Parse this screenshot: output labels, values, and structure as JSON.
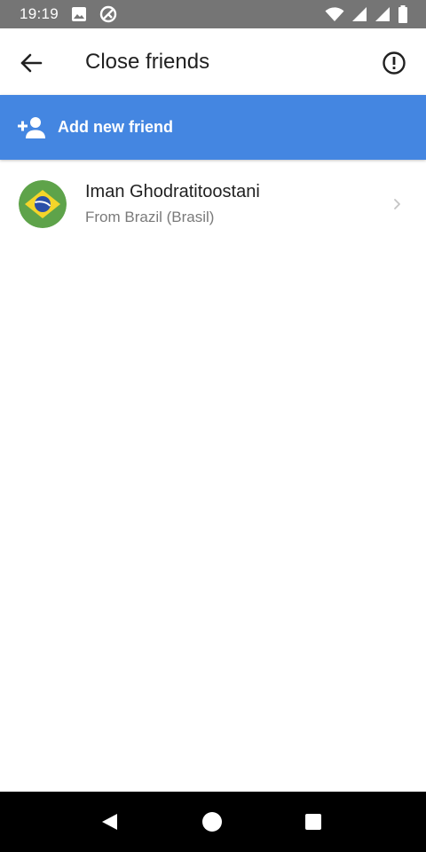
{
  "status_bar": {
    "time": "19:19",
    "icons": [
      "image-icon",
      "sync-icon",
      "wifi-icon",
      "signal-icon",
      "signal-icon-2",
      "battery-icon"
    ]
  },
  "app_bar": {
    "title": "Close friends",
    "back_icon": "arrow-left-icon",
    "info_icon": "exclamation-circle-icon"
  },
  "add_friend": {
    "label": "Add new friend",
    "icon": "person-add-icon",
    "background": "#4486e1"
  },
  "friends": [
    {
      "name": "Iman Ghodratitoostani",
      "subtitle": "From Brazil (Brasil)",
      "avatar": "brazil-flag-icon"
    }
  ],
  "nav_bar": {
    "icons": [
      "nav-back-icon",
      "nav-home-icon",
      "nav-recents-icon"
    ]
  }
}
